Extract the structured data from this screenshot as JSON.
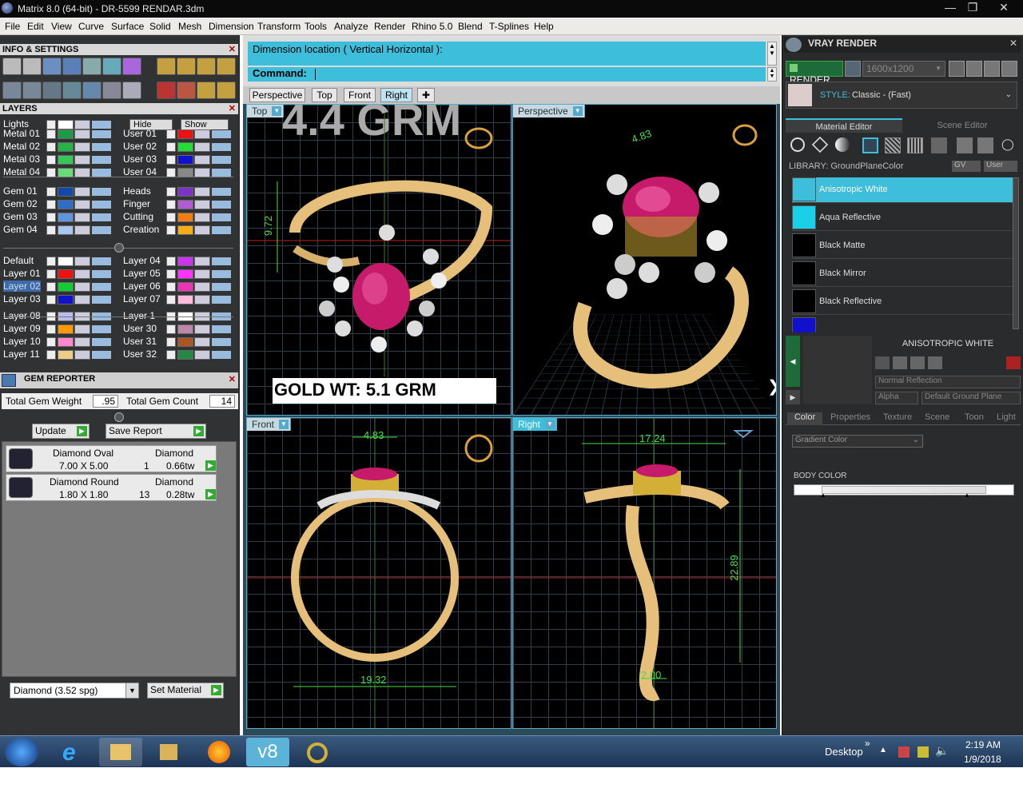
{
  "window": {
    "title": "Matrix 8.0 (64-bit) - DR-5599 RENDAR.3dm"
  },
  "menu": [
    "File",
    "Edit",
    "View",
    "Curve",
    "Surface",
    "Solid",
    "Mesh",
    "Dimension",
    "Transform",
    "Tools",
    "Analyze",
    "Render",
    "Rhino 5.0",
    "Blend",
    "T-Splines",
    "Help"
  ],
  "left": {
    "info_title": "INFO & SETTINGS",
    "layers_title": "LAYERS",
    "lights_label": "Lights",
    "hide_label": "Hide",
    "show_label": "Show",
    "col1a": [
      {
        "name": "Metal 01",
        "color": "#1f9a44"
      },
      {
        "name": "Metal 02",
        "color": "#25b347"
      },
      {
        "name": "Metal 03",
        "color": "#36c759"
      },
      {
        "name": "Metal 04",
        "color": "#69d97c"
      }
    ],
    "col2a": [
      {
        "name": "User 01",
        "color": "#e11"
      },
      {
        "name": "User 02",
        "color": "#2d3"
      },
      {
        "name": "User 03",
        "color": "#11c"
      },
      {
        "name": "User 04",
        "color": "#888"
      }
    ],
    "col1b": [
      {
        "name": "Gem 01",
        "color": "#1448a8"
      },
      {
        "name": "Gem 02",
        "color": "#2f6cc6"
      },
      {
        "name": "Gem 03",
        "color": "#5f95df"
      },
      {
        "name": "Gem 04",
        "color": "#a8c6ee"
      }
    ],
    "col2b": [
      {
        "name": "Heads",
        "color": "#7a33c4"
      },
      {
        "name": "Finger",
        "color": "#b05ad4"
      },
      {
        "name": "Cutting",
        "color": "#f27c14"
      },
      {
        "name": "Creation",
        "color": "#f5ad16"
      }
    ],
    "col1c": [
      {
        "name": "Default",
        "color": "#fff"
      },
      {
        "name": "Layer 01",
        "color": "#e11"
      },
      {
        "name": "Layer 02",
        "color": "#1c3"
      },
      {
        "name": "Layer 03",
        "color": "#11c"
      }
    ],
    "col2c": [
      {
        "name": "Layer 04",
        "color": "#c3e"
      },
      {
        "name": "Layer 05",
        "color": "#f3f"
      },
      {
        "name": "Layer 06",
        "color": "#e3b"
      },
      {
        "name": "Layer 07",
        "color": "#fbd"
      }
    ],
    "col1d": [
      {
        "name": "Layer 08",
        "color": "#bbe"
      },
      {
        "name": "Layer 09",
        "color": "#f90"
      },
      {
        "name": "Layer 10",
        "color": "#f8c"
      },
      {
        "name": "Layer 11",
        "color": "#ec8"
      }
    ],
    "col2d": [
      {
        "name": "Layer 1",
        "color": "#fff"
      },
      {
        "name": "User 30",
        "color": "#b8a"
      },
      {
        "name": "User 31",
        "color": "#a52"
      },
      {
        "name": "User 32",
        "color": "#284"
      }
    ],
    "gem_reporter": {
      "title": "GEM REPORTER",
      "total_weight_label": "Total Gem Weight",
      "total_weight": ".95",
      "total_count_label": "Total Gem Count",
      "total_count": "14",
      "update": "Update",
      "save_report": "Save Report",
      "rows": [
        {
          "name": "Diamond Oval",
          "material": "Diamond",
          "size": "7.00 X 5.00",
          "qty": "1",
          "wt": "0.66tw"
        },
        {
          "name": "Diamond Round",
          "material": "Diamond",
          "size": "1.80 X 1.80",
          "qty": "13",
          "wt": "0.28tw"
        }
      ],
      "material_select": "Diamond     (3.52 spg)",
      "set_material": "Set Material"
    }
  },
  "command": {
    "prompt": "Dimension location ( Vertical  Horizontal ):",
    "label": "Command:"
  },
  "vtabs": [
    "Perspective",
    "Top",
    "Front",
    "Right"
  ],
  "viewports": {
    "top": {
      "label": "Top",
      "watermark": "4.4 GRM",
      "gold": "GOLD WT: 5.1 GRM",
      "dim": "9.72"
    },
    "persp": {
      "label": "Perspective",
      "dim": "4.83"
    },
    "front": {
      "label": "Front",
      "dim_top": "4.83",
      "dim_bottom": "19.32"
    },
    "right": {
      "label": "Right",
      "dim_top": "17.24",
      "dim_side": "22.89",
      "dim_bottom": "2.00"
    }
  },
  "right": {
    "title": "VRAY RENDER",
    "render": "RENDER",
    "resolution": "1600x1200",
    "style_label": "STYLE:",
    "style": "Classic - (Fast)",
    "tab_material": "Material Editor",
    "tab_scene": "Scene Editor",
    "library": "LIBRARY: GroundPlaneColor",
    "gv": "GV",
    "user": "User",
    "materials": [
      {
        "name": "Anisotropic White",
        "color": "#222"
      },
      {
        "name": "Aqua Reflective",
        "color": "#19d0e8"
      },
      {
        "name": "Black Matte",
        "color": "#000"
      },
      {
        "name": "Black Mirror",
        "color": "#000"
      },
      {
        "name": "Black Reflective",
        "color": "#000"
      }
    ],
    "selected_name": "ANISOTROPIC WHITE",
    "reflection": "Normal Reflection",
    "alpha": "Alpha",
    "ground": "Default Ground Plane",
    "subtabs": [
      "Color",
      "Properties",
      "Texture",
      "Scene",
      "Toon",
      "Light"
    ],
    "gradient": "Gradient Color",
    "body_color": "BODY COLOR"
  },
  "taskbar": {
    "desktop": "Desktop",
    "time": "2:19 AM",
    "date": "1/9/2018",
    "v8": "v8"
  }
}
